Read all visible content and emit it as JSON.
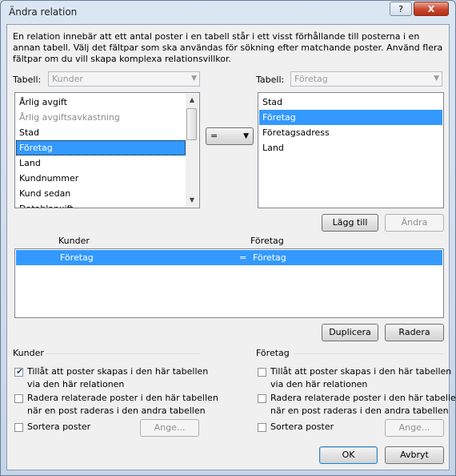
{
  "window": {
    "title": "Ändra relation",
    "help_glyph": "?",
    "close_glyph": "X"
  },
  "description": "En relation innebär att ett antal poster i en tabell står i ett visst förhållande till posterna i en annan tabell. Välj det fältpar som ska användas för sökning efter matchande poster. Använd flera fältpar om du vill skapa komplexa relationsvillkor.",
  "left_table": {
    "label": "Tabell:",
    "selected": "Kunder",
    "fields": [
      "Årlig avgift",
      "Årlig avgiftsavkastning",
      "Stad",
      "Företag",
      "Land",
      "Kundnummer",
      "Kund sedan",
      "Datablanxift"
    ],
    "selected_field": "Företag",
    "dimmed_field": "Årlig avgiftsavkastning"
  },
  "operator": {
    "value": "="
  },
  "right_table": {
    "label": "Tabell:",
    "selected": "Företag",
    "fields": [
      "Stad",
      "Företag",
      "Företagsadress",
      "Land"
    ],
    "selected_field": "Företag"
  },
  "buttons": {
    "add": "Lägg till",
    "change": "Ändra",
    "duplicate": "Duplicera",
    "delete": "Radera",
    "ok": "OK",
    "cancel": "Avbryt"
  },
  "relations": {
    "header_left": "Kunder",
    "header_right": "Företag",
    "rows": [
      {
        "left": "Företag",
        "op": "=",
        "right": "Företag"
      }
    ]
  },
  "left_options": {
    "header": "Kunder",
    "create_line1": "Tillåt att poster skapas i den här tabellen",
    "create_line2": "via den här relationen",
    "create_checked": true,
    "delete_line1": "Radera relaterade poster i den här tabellen",
    "delete_line2": "när en post raderas i den andra tabellen",
    "delete_checked": false,
    "sort_label": "Sortera poster",
    "sort_checked": false,
    "specify": "Ange..."
  },
  "right_options": {
    "header": "Företag",
    "create_line1": "Tillåt att poster skapas i den här tabellen",
    "create_line2": "via den här relationen",
    "create_checked": false,
    "delete_line1": "Radera relaterade poster i den här tabellen",
    "delete_line2": "när en post raderas i den andra tabellen",
    "delete_checked": false,
    "sort_label": "Sortera poster",
    "sort_checked": false,
    "specify": "Ange..."
  }
}
